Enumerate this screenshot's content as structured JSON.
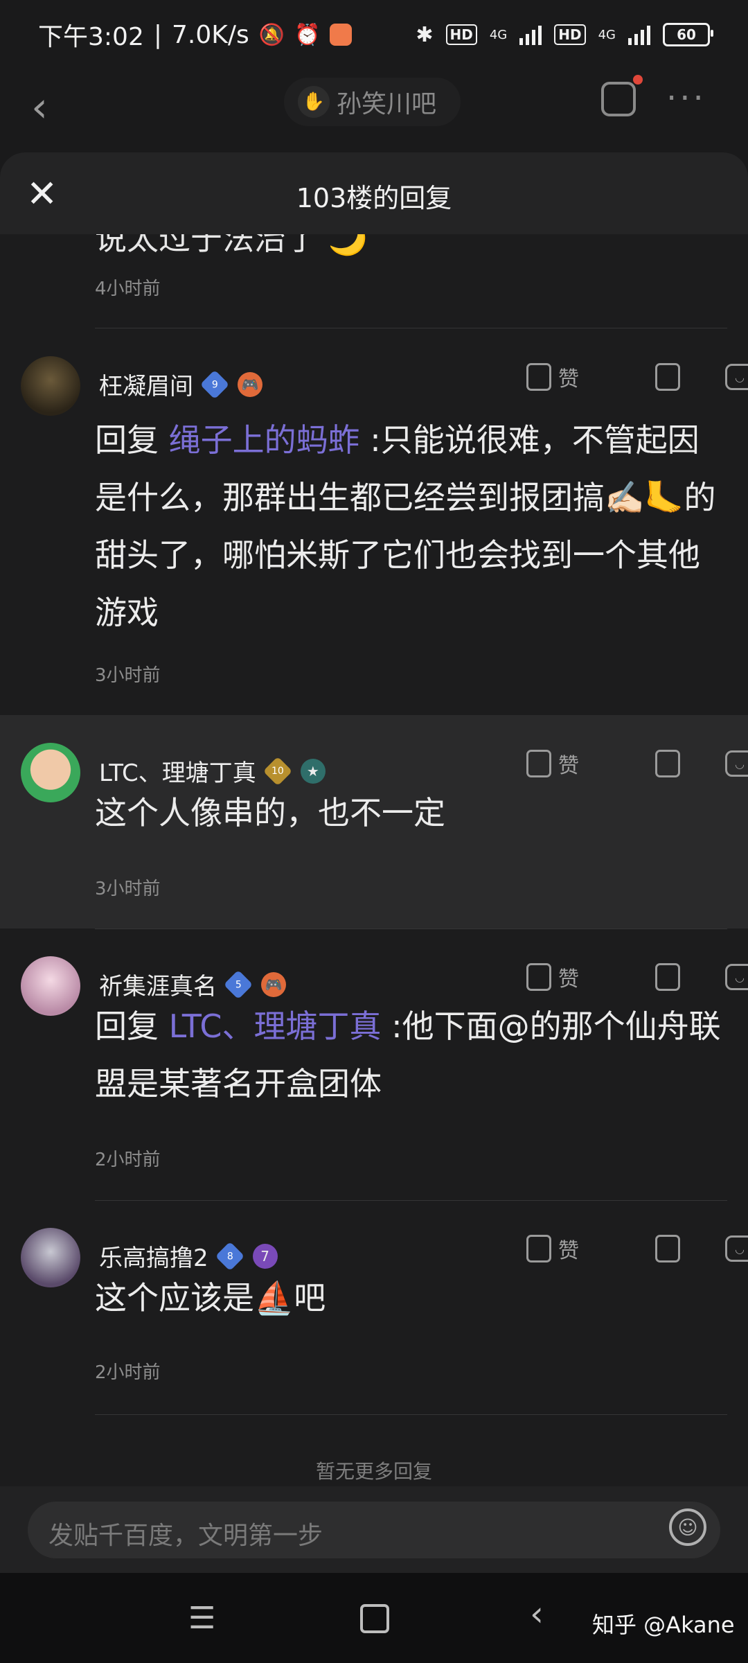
{
  "status": {
    "time": "下午3:02",
    "speed": "7.0K/s",
    "battery": "60",
    "net1": "4G",
    "net2": "4G",
    "hd": "HD"
  },
  "nav": {
    "forum": "孙笑川吧"
  },
  "sheet": {
    "title": "103楼的回复",
    "prev_text": "说太过于法治了 🌙",
    "prev_time": "4小时前"
  },
  "replies": [
    {
      "name": "枉凝眉间",
      "level": "9",
      "prefix": "回复 ",
      "mention": "绳子上的蚂蚱",
      "text": " :只能说很难，不管起因是什么，那群出生都已经尝到报团搞✍🏻🦶的甜头了，哪怕米斯了它们也会找到一个其他游戏",
      "time": "3小时前",
      "like": "赞"
    },
    {
      "name": "LTC、理塘丁真",
      "level": "10",
      "prefix": "",
      "mention": "",
      "text": "这个人像串的，也不一定",
      "time": "3小时前",
      "like": "赞"
    },
    {
      "name": "祈集涯真名",
      "level": "5",
      "prefix": "回复 ",
      "mention": "LTC、理塘丁真",
      "text": " :他下面@的那个仙舟联盟是某著名开盒团体",
      "time": "2小时前",
      "like": "赞"
    },
    {
      "name": "乐高搞撸2",
      "level": "8",
      "prefix": "",
      "mention": "",
      "text": "这个应该是⛵吧",
      "time": "2小时前",
      "like": "赞"
    }
  ],
  "footer": {
    "no_more": "暂无更多回复",
    "input_placeholder": "发贴千百度，文明第一步",
    "watermark": "知乎 @Akane"
  },
  "icons": [
    "back-icon",
    "edit-icon",
    "more-icon",
    "close-icon",
    "like-icon",
    "dislike-icon",
    "comment-icon",
    "emoji-icon",
    "menu-icon",
    "home-icon",
    "nav-back-icon"
  ],
  "colors": {
    "mention": "#7b6fd6",
    "background": "#1c1c1d",
    "highlight_row": "#2a2a2b"
  }
}
